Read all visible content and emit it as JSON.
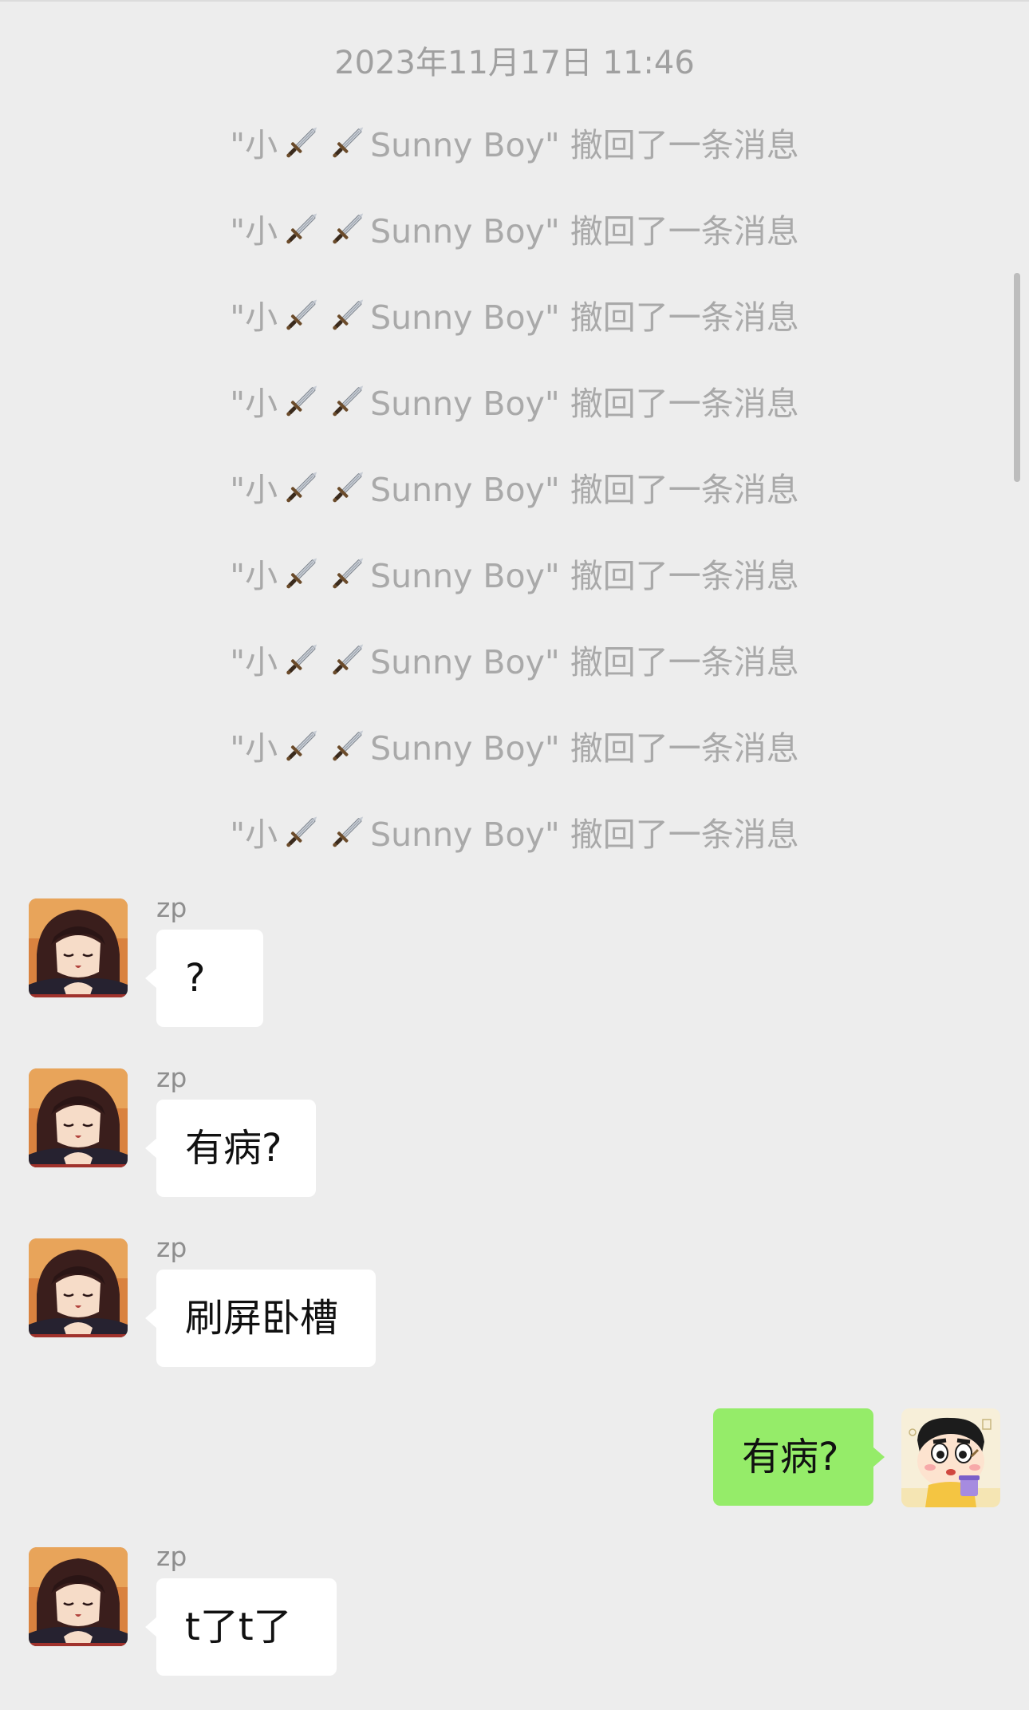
{
  "chat": {
    "timestamp": "2023年11月17日 11:46",
    "recall_prefix": "\"小",
    "recall_suffix": "Sunny Boy\" 撤回了一条消息",
    "recall_count": 9,
    "messages": [
      {
        "sender": "zp",
        "text": "?"
      },
      {
        "sender": "zp",
        "text": "有病?"
      },
      {
        "sender": "zp",
        "text": "刷屏卧槽"
      },
      {
        "sender": "me",
        "text": "有病?"
      },
      {
        "sender": "zp",
        "text": "t了t了"
      }
    ]
  },
  "icons": {
    "recall_emoji": "dagger-icon",
    "contact_avatar": "anime-character-avatar",
    "my_avatar": "crayon-shin-chan-avatar"
  },
  "colors": {
    "background": "#ededed",
    "incoming_bubble": "#ffffff",
    "outgoing_bubble": "#95ec69",
    "system_text": "#a9a9a9"
  }
}
